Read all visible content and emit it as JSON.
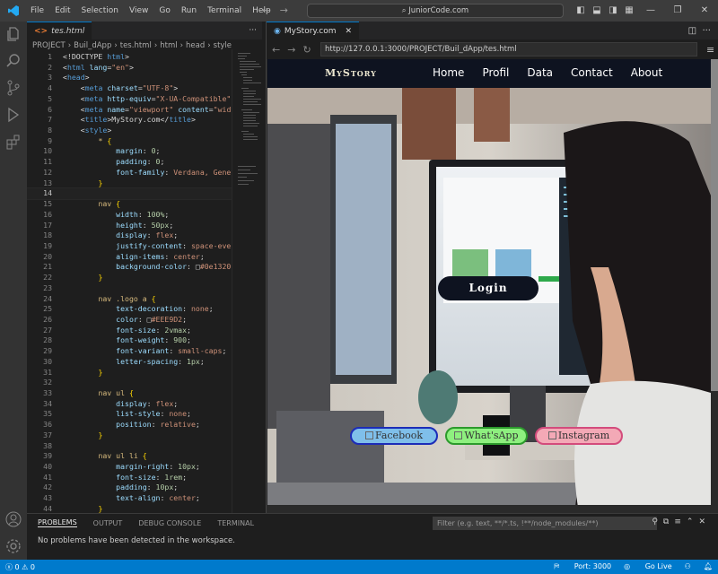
{
  "titlebar": {
    "menu": [
      "File",
      "Edit",
      "Selection",
      "View",
      "Go",
      "Run",
      "Terminal",
      "Help"
    ],
    "search": "JuniorCode.com"
  },
  "editor": {
    "tab": "tes.html",
    "breadcrumb": [
      "PROJECT",
      "Buil_dApp",
      "tes.html",
      "html",
      "head",
      "style"
    ],
    "lines": [
      {
        "n": "1",
        "html": "<span class='tok-txt'>&lt;!DOCTYPE </span><span class='tok-tag'>html</span><span class='tok-txt'>&gt;</span>"
      },
      {
        "n": "2",
        "html": "<span class='tok-txt'>&lt;</span><span class='tok-tag'>html</span> <span class='tok-attr'>lang</span><span class='tok-txt'>=</span><span class='tok-str'>\"en\"</span><span class='tok-txt'>&gt;</span>"
      },
      {
        "n": "3",
        "html": "<span class='tok-txt'>&lt;</span><span class='tok-tag'>head</span><span class='tok-txt'>&gt;</span>"
      },
      {
        "n": "4",
        "html": "    <span class='tok-txt'>&lt;</span><span class='tok-tag'>meta</span> <span class='tok-attr'>charset</span><span class='tok-txt'>=</span><span class='tok-str'>\"UTF-8\"</span><span class='tok-txt'>&gt;</span>"
      },
      {
        "n": "5",
        "html": "    <span class='tok-txt'>&lt;</span><span class='tok-tag'>meta</span> <span class='tok-attr'>http-equiv</span><span class='tok-txt'>=</span><span class='tok-str'>\"X-UA-Compatible\"</span>"
      },
      {
        "n": "6",
        "html": "    <span class='tok-txt'>&lt;</span><span class='tok-tag'>meta</span> <span class='tok-attr'>name</span><span class='tok-txt'>=</span><span class='tok-str'>\"viewport\"</span> <span class='tok-attr'>content</span><span class='tok-txt'>=</span><span class='tok-str'>\"widt</span>"
      },
      {
        "n": "7",
        "html": "    <span class='tok-txt'>&lt;</span><span class='tok-tag'>title</span><span class='tok-txt'>&gt;MyStory.com&lt;/</span><span class='tok-tag'>title</span><span class='tok-txt'>&gt;</span>"
      },
      {
        "n": "8",
        "html": "    <span class='tok-txt'>&lt;</span><span class='tok-tag'>style</span><span class='tok-txt'>&gt;</span>"
      },
      {
        "n": "9",
        "html": "        <span class='tok-sel'>*</span> <span class='tok-brk'>{</span>"
      },
      {
        "n": "10",
        "html": "            <span class='tok-prop'>margin</span><span class='tok-txt'>: </span><span class='tok-num'>0</span><span class='tok-txt'>;</span>"
      },
      {
        "n": "11",
        "html": "            <span class='tok-prop'>padding</span><span class='tok-txt'>: </span><span class='tok-num'>0</span><span class='tok-txt'>;</span>"
      },
      {
        "n": "12",
        "html": "            <span class='tok-prop'>font-family</span><span class='tok-txt'>: </span><span class='tok-val'>Verdana, Geneva</span>"
      },
      {
        "n": "13",
        "html": "        <span class='tok-brk'>}</span>"
      },
      {
        "n": "14",
        "html": "",
        "cur": true
      },
      {
        "n": "15",
        "html": "        <span class='tok-sel'>nav</span> <span class='tok-brk'>{</span>"
      },
      {
        "n": "16",
        "html": "            <span class='tok-prop'>width</span><span class='tok-txt'>: </span><span class='tok-num'>100%</span><span class='tok-txt'>;</span>"
      },
      {
        "n": "17",
        "html": "            <span class='tok-prop'>height</span><span class='tok-txt'>: </span><span class='tok-num'>50px</span><span class='tok-txt'>;</span>"
      },
      {
        "n": "18",
        "html": "            <span class='tok-prop'>display</span><span class='tok-txt'>: </span><span class='tok-val'>flex</span><span class='tok-txt'>;</span>"
      },
      {
        "n": "19",
        "html": "            <span class='tok-prop'>justify-content</span><span class='tok-txt'>: </span><span class='tok-val'>space-even</span>"
      },
      {
        "n": "20",
        "html": "            <span class='tok-prop'>align-items</span><span class='tok-txt'>: </span><span class='tok-val'>center</span><span class='tok-txt'>;</span>"
      },
      {
        "n": "21",
        "html": "            <span class='tok-prop'>background-color</span><span class='tok-txt'>: </span><span class='tok-txt'>&#9633;</span><span class='tok-val'>#0e1320</span>"
      },
      {
        "n": "22",
        "html": "        <span class='tok-brk'>}</span>"
      },
      {
        "n": "23",
        "html": ""
      },
      {
        "n": "24",
        "html": "        <span class='tok-sel'>nav .logo a</span> <span class='tok-brk'>{</span>"
      },
      {
        "n": "25",
        "html": "            <span class='tok-prop'>text-decoration</span><span class='tok-txt'>: </span><span class='tok-val'>none</span><span class='tok-txt'>;</span>"
      },
      {
        "n": "26",
        "html": "            <span class='tok-prop'>color</span><span class='tok-txt'>: &#9633;</span><span class='tok-val'>#EEE9D2</span><span class='tok-txt'>;</span>"
      },
      {
        "n": "27",
        "html": "            <span class='tok-prop'>font-size</span><span class='tok-txt'>: </span><span class='tok-num'>2vmax</span><span class='tok-txt'>;</span>"
      },
      {
        "n": "28",
        "html": "            <span class='tok-prop'>font-weight</span><span class='tok-txt'>: </span><span class='tok-num'>900</span><span class='tok-txt'>;</span>"
      },
      {
        "n": "29",
        "html": "            <span class='tok-prop'>font-variant</span><span class='tok-txt'>: </span><span class='tok-val'>small-caps</span><span class='tok-txt'>;</span>"
      },
      {
        "n": "30",
        "html": "            <span class='tok-prop'>letter-spacing</span><span class='tok-txt'>: </span><span class='tok-num'>1px</span><span class='tok-txt'>;</span>"
      },
      {
        "n": "31",
        "html": "        <span class='tok-brk'>}</span>"
      },
      {
        "n": "32",
        "html": ""
      },
      {
        "n": "33",
        "html": "        <span class='tok-sel'>nav ul</span> <span class='tok-brk'>{</span>"
      },
      {
        "n": "34",
        "html": "            <span class='tok-prop'>display</span><span class='tok-txt'>: </span><span class='tok-val'>flex</span><span class='tok-txt'>;</span>"
      },
      {
        "n": "35",
        "html": "            <span class='tok-prop'>list-style</span><span class='tok-txt'>: </span><span class='tok-val'>none</span><span class='tok-txt'>;</span>"
      },
      {
        "n": "36",
        "html": "            <span class='tok-prop'>position</span><span class='tok-txt'>: </span><span class='tok-val'>relative</span><span class='tok-txt'>;</span>"
      },
      {
        "n": "37",
        "html": "        <span class='tok-brk'>}</span>"
      },
      {
        "n": "38",
        "html": ""
      },
      {
        "n": "39",
        "html": "        <span class='tok-sel'>nav ul li</span> <span class='tok-brk'>{</span>"
      },
      {
        "n": "40",
        "html": "            <span class='tok-prop'>margin-right</span><span class='tok-txt'>: </span><span class='tok-num'>10px</span><span class='tok-txt'>;</span>"
      },
      {
        "n": "41",
        "html": "            <span class='tok-prop'>font-size</span><span class='tok-txt'>: </span><span class='tok-num'>1rem</span><span class='tok-txt'>;</span>"
      },
      {
        "n": "42",
        "html": "            <span class='tok-prop'>padding</span><span class='tok-txt'>: </span><span class='tok-num'>10px</span><span class='tok-txt'>;</span>"
      },
      {
        "n": "43",
        "html": "            <span class='tok-prop'>text-align</span><span class='tok-txt'>: </span><span class='tok-val'>center</span><span class='tok-txt'>;</span>"
      },
      {
        "n": "44",
        "html": "        <span class='tok-brk'>}</span>"
      }
    ]
  },
  "browser": {
    "tab": "MyStory.com",
    "url": "http://127.0.0.1:3000/PROJECT/Buil_dApp/tes.html"
  },
  "site": {
    "logo": "MyStory",
    "nav": [
      "Home",
      "Profil",
      "Data",
      "Contact",
      "About"
    ],
    "login": "Login",
    "social": [
      "Facebook",
      "What'sApp",
      "Instagram"
    ]
  },
  "panel": {
    "tabs": [
      "PROBLEMS",
      "OUTPUT",
      "DEBUG CONSOLE",
      "TERMINAL"
    ],
    "filter_placeholder": "Filter (e.g. text, **/*.ts, !**/node_modules/**)",
    "message": "No problems have been detected in the workspace."
  },
  "statusbar": {
    "errors": "0",
    "warnings": "0",
    "port": "Port: 3000",
    "golive": "Go Live"
  }
}
